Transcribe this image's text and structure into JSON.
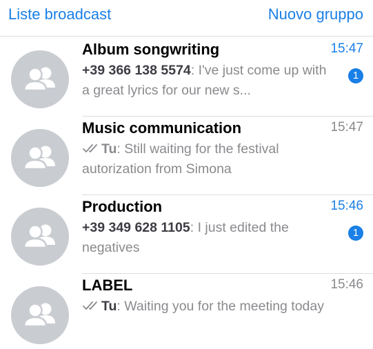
{
  "header": {
    "left_label": "Liste broadcast",
    "right_label": "Nuovo gruppo"
  },
  "colors": {
    "accent": "#1a7fe6",
    "secondary_text": "#8a8a8e",
    "avatar_bg": "#c9ccd1"
  },
  "chats": [
    {
      "name": "Album songwriting",
      "time": "15:47",
      "sender": "+39 366 138 5574",
      "message": "I've just come up with a great lyrics for our new s...",
      "unread": "1",
      "sent_ticks": false,
      "avatar_icon": "group-icon"
    },
    {
      "name": "Music communication",
      "time": "15:47",
      "sender": "Tu",
      "message": "Still waiting for the festival autorization from Simona",
      "unread": "",
      "sent_ticks": true,
      "avatar_icon": "group-icon"
    },
    {
      "name": "Production",
      "time": "15:46",
      "sender": "+39 349 628 1105",
      "message": "I just edited the negatives",
      "unread": "1",
      "sent_ticks": false,
      "avatar_icon": "group-icon"
    },
    {
      "name": "LABEL",
      "time": "15:46",
      "sender": "Tu",
      "message": "Waiting you for the meeting today",
      "unread": "",
      "sent_ticks": true,
      "avatar_icon": "group-icon"
    }
  ]
}
